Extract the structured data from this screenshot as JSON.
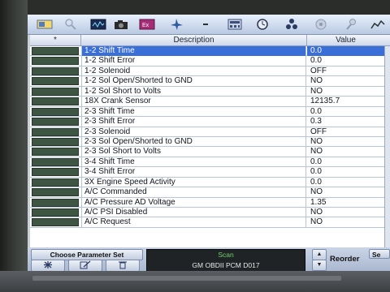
{
  "grid": {
    "col_star": "*",
    "col_description": "Description",
    "col_value": "Value",
    "rows": [
      {
        "description": "1-2 Shift Time",
        "value": "0.0",
        "selected": true
      },
      {
        "description": "1-2 Shift Error",
        "value": "0.0"
      },
      {
        "description": "1-2 Solenoid",
        "value": "OFF"
      },
      {
        "description": "1-2 Sol Open/Shorted to GND",
        "value": "NO"
      },
      {
        "description": "1-2 Sol Short to Volts",
        "value": "NO"
      },
      {
        "description": "18X Crank Sensor",
        "value": "12135.7"
      },
      {
        "description": "2-3 Shift Time",
        "value": "0.0"
      },
      {
        "description": "2-3 Shift Error",
        "value": "0.3"
      },
      {
        "description": "2-3 Solenoid",
        "value": "OFF"
      },
      {
        "description": "2-3 Sol Open/Shorted to GND",
        "value": "NO"
      },
      {
        "description": "2-3 Sol Short to Volts",
        "value": "NO"
      },
      {
        "description": "3-4 Shift Time",
        "value": "0.0"
      },
      {
        "description": "3-4 Shift Error",
        "value": "0.0"
      },
      {
        "description": "3X Engine Speed Activity",
        "value": "0.0"
      },
      {
        "description": "A/C Commanded",
        "value": "NO"
      },
      {
        "description": "A/C Pressure AD Voltage",
        "value": "1.35"
      },
      {
        "description": "A/C PSI Disabled",
        "value": "NO"
      },
      {
        "description": "A/C Request",
        "value": "NO"
      }
    ]
  },
  "toolbar": {
    "icons": [
      "graph-select-icon",
      "search-icon",
      "scope-icon",
      "camera-icon",
      "report-icon",
      "plane-icon",
      "minus-icon",
      "calculator-icon",
      "clock-icon",
      "network-icon",
      "disc-icon",
      "pin-icon",
      "chart-icon"
    ]
  },
  "bottom": {
    "choose_label": "Choose Parameter Set",
    "scan_title": "Scan",
    "scan_subtitle": "GM OBDII PCM D017",
    "reorder_label": "Reorder",
    "se_label": "Se",
    "up_arrow": "▲",
    "down_arrow": "▼"
  },
  "colors": {
    "selected_row": "#3a6fd8",
    "swatch": "#3d5542",
    "scan_title": "#6fd36a"
  }
}
